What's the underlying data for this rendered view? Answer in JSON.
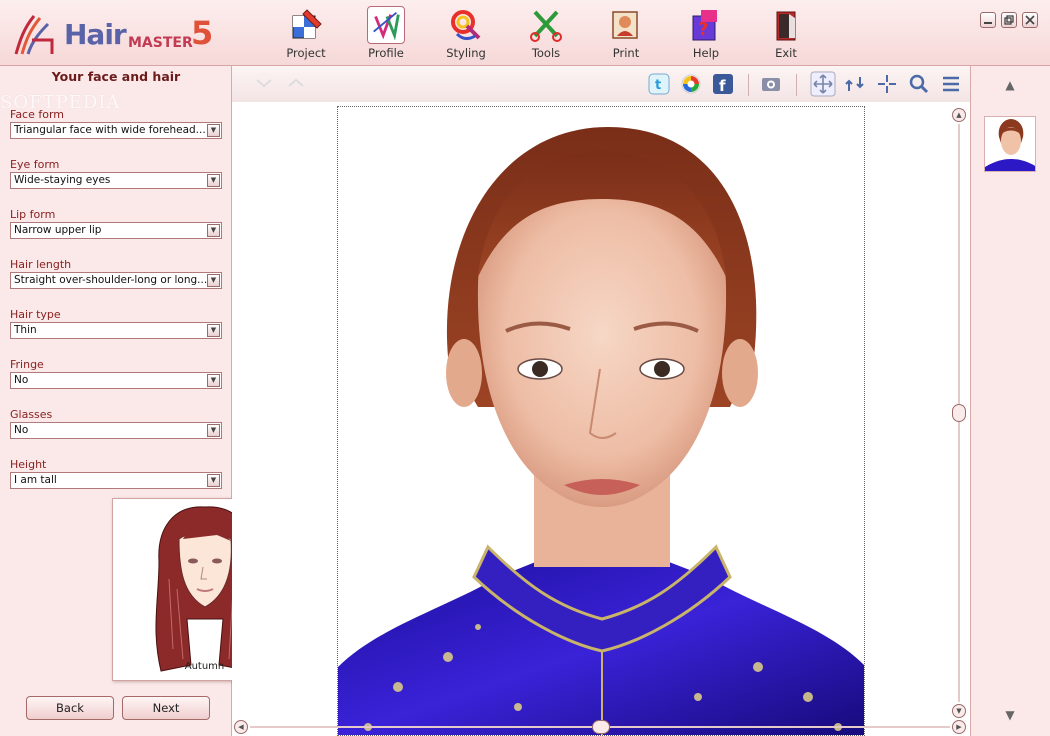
{
  "app": {
    "logo_word": "Hair",
    "logo_master": "MASTER",
    "logo_version": "5"
  },
  "toolbar": [
    {
      "label": "Project",
      "icon": "project-icon"
    },
    {
      "label": "Profile",
      "icon": "profile-icon",
      "active": true
    },
    {
      "label": "Styling",
      "icon": "styling-icon"
    },
    {
      "label": "Tools",
      "icon": "tools-icon"
    },
    {
      "label": "Print",
      "icon": "print-icon"
    },
    {
      "label": "Help",
      "icon": "help-icon"
    },
    {
      "label": "Exit",
      "icon": "exit-icon"
    }
  ],
  "left_panel": {
    "title": "Your face and hair",
    "watermark": "SOFTPEDIA",
    "fields": [
      {
        "label": "Face form",
        "value": "Triangular face with wide forehead..."
      },
      {
        "label": "Eye form",
        "value": "Wide-staying eyes"
      },
      {
        "label": "Lip form",
        "value": "Narrow upper lip"
      },
      {
        "label": "Hair length",
        "value": "Straight over-shoulder-long or long..."
      },
      {
        "label": "Hair type",
        "value": "Thin"
      },
      {
        "label": "Fringe",
        "value": "No"
      },
      {
        "label": "Glasses",
        "value": "No"
      },
      {
        "label": "Height",
        "value": "I am tall"
      }
    ],
    "preview_caption": "Autumn",
    "back_label": "Back",
    "next_label": "Next"
  },
  "center_toolbar_icons": [
    "twitter-icon",
    "share-icon",
    "facebook-icon",
    "camera-icon",
    "move-icon",
    "rotate-icon",
    "crosshair-icon",
    "zoom-icon",
    "menu-icon"
  ],
  "colors": {
    "accent": "#c23b52",
    "panel_bg": "#fbe9e9",
    "border": "#d9a9a9",
    "dress_blue": "#2c18c4",
    "hair": "#8c3a1f"
  }
}
